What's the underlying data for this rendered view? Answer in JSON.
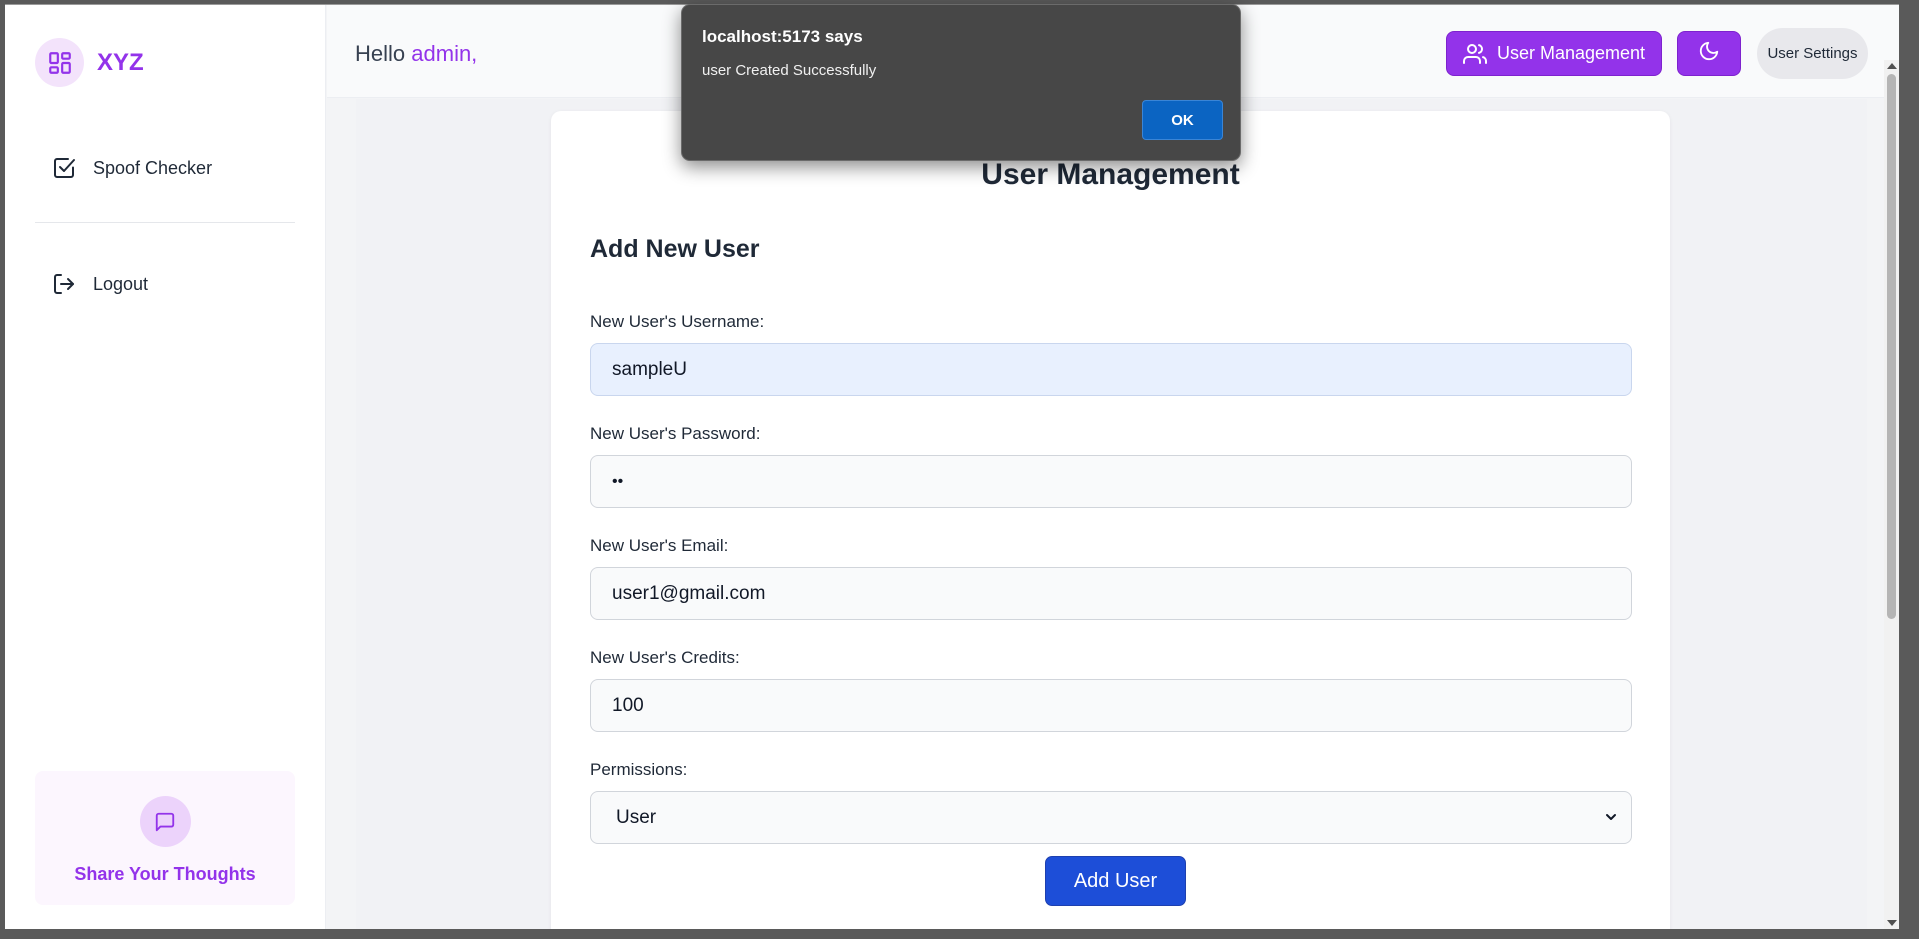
{
  "sidebar": {
    "brand": "XYZ",
    "items": [
      {
        "label": "Spoof Checker",
        "icon": "checkbox-icon"
      },
      {
        "label": "Logout",
        "icon": "logout-icon"
      }
    ],
    "feedback": {
      "label": "Share Your Thoughts",
      "icon": "message-icon"
    }
  },
  "header": {
    "greeting": "Hello",
    "username": "admin,",
    "user_management_label": "User Management",
    "theme_toggle_icon": "moon-icon",
    "settings_label": "User Settings"
  },
  "main": {
    "title": "User Management",
    "section_title": "Add New User",
    "fields": [
      {
        "label": "New User's Username:",
        "value": "sampleU"
      },
      {
        "label": "New User's Password:",
        "value": "••"
      },
      {
        "label": "New User's Email:",
        "value": "user1@gmail.com"
      },
      {
        "label": "New User's Credits:",
        "value": "100"
      },
      {
        "label": "Permissions:",
        "value": "User"
      }
    ],
    "submit_label": "Add User"
  },
  "dialog": {
    "title": "localhost:5173 says",
    "message": "user Created Successfully",
    "ok_label": "OK"
  },
  "colors": {
    "accent": "#9333ea",
    "primary_button": "#1d4ed8",
    "dialog_bg": "#474747",
    "dialog_ok": "#0b64c2"
  }
}
